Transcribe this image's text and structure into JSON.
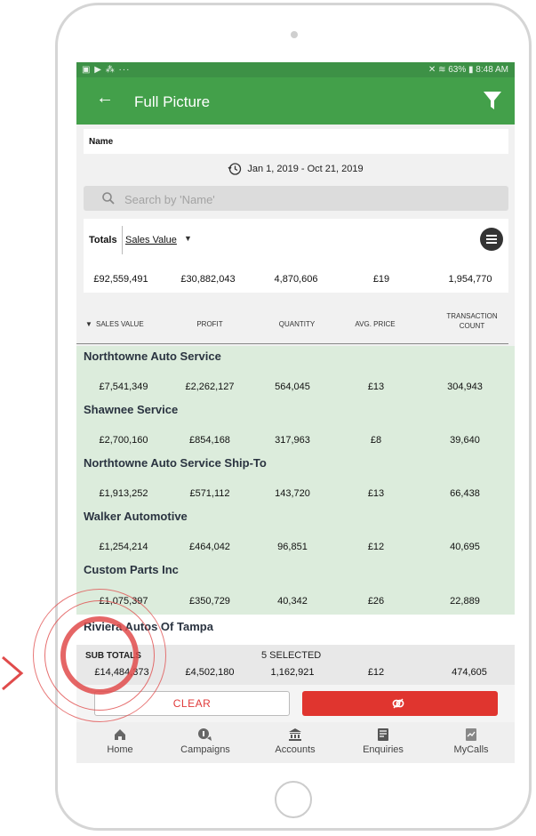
{
  "statusbar": {
    "left": "▣ ▶ ⁂ ···",
    "right": "✕ ≋ 63% ▮ 8:48 AM"
  },
  "appbar": {
    "title": "Full Picture",
    "back_icon": "arrow-left-icon",
    "filter_icon": "filter-icon"
  },
  "name_label": "Name",
  "date_range": "Jan 1, 2019 - Oct 21, 2019",
  "search": {
    "placeholder": "Search by 'Name'"
  },
  "totals": {
    "label": "Totals",
    "metric": "Sales Value",
    "values": [
      "£92,559,491",
      "£30,882,043",
      "4,870,606",
      "£19",
      "1,954,770"
    ]
  },
  "columns": {
    "sort_indicator": "▼",
    "sales_value": "SALES VALUE",
    "profit": "PROFIT",
    "quantity": "QUANTITY",
    "avg_price": "AVG. PRICE",
    "transaction_count": "TRANSACTION COUNT"
  },
  "rows": [
    {
      "name": "Northtowne Auto Service",
      "values": [
        "£7,541,349",
        "£2,262,127",
        "564,045",
        "£13",
        "304,943"
      ]
    },
    {
      "name": "Shawnee Service",
      "values": [
        "£2,700,160",
        "£854,168",
        "317,963",
        "£8",
        "39,640"
      ]
    },
    {
      "name": "Northtowne Auto Service Ship-To",
      "values": [
        "£1,913,252",
        "£571,112",
        "143,720",
        "£13",
        "66,438"
      ]
    },
    {
      "name": "Walker Automotive",
      "values": [
        "£1,254,214",
        "£464,042",
        "96,851",
        "£12",
        "40,695"
      ]
    },
    {
      "name": "Custom Parts Inc",
      "values": [
        "£1,075,397",
        "£350,729",
        "40,342",
        "£26",
        "22,889"
      ]
    }
  ],
  "partial_row": {
    "name": "Riviera Autos Of Tampa"
  },
  "subtotals": {
    "label": "SUB TOTALS",
    "selected": "5 SELECTED",
    "values": [
      "£14,484,373",
      "£4,502,180",
      "1,162,921",
      "£12",
      "474,605"
    ]
  },
  "actions": {
    "clear": "CLEAR",
    "apply_icon": "link-icon"
  },
  "nav": [
    {
      "label": "Home",
      "icon": "home-icon"
    },
    {
      "label": "Campaigns",
      "icon": "campaigns-icon"
    },
    {
      "label": "Accounts",
      "icon": "bank-icon"
    },
    {
      "label": "Enquiries",
      "icon": "enquiries-icon"
    },
    {
      "label": "MyCalls",
      "icon": "mycalls-icon"
    }
  ],
  "colors": {
    "header_green": "#43a04a",
    "row_green": "#dcecdc",
    "action_red": "#e0352f",
    "highlight_red": "#e04b4b"
  }
}
